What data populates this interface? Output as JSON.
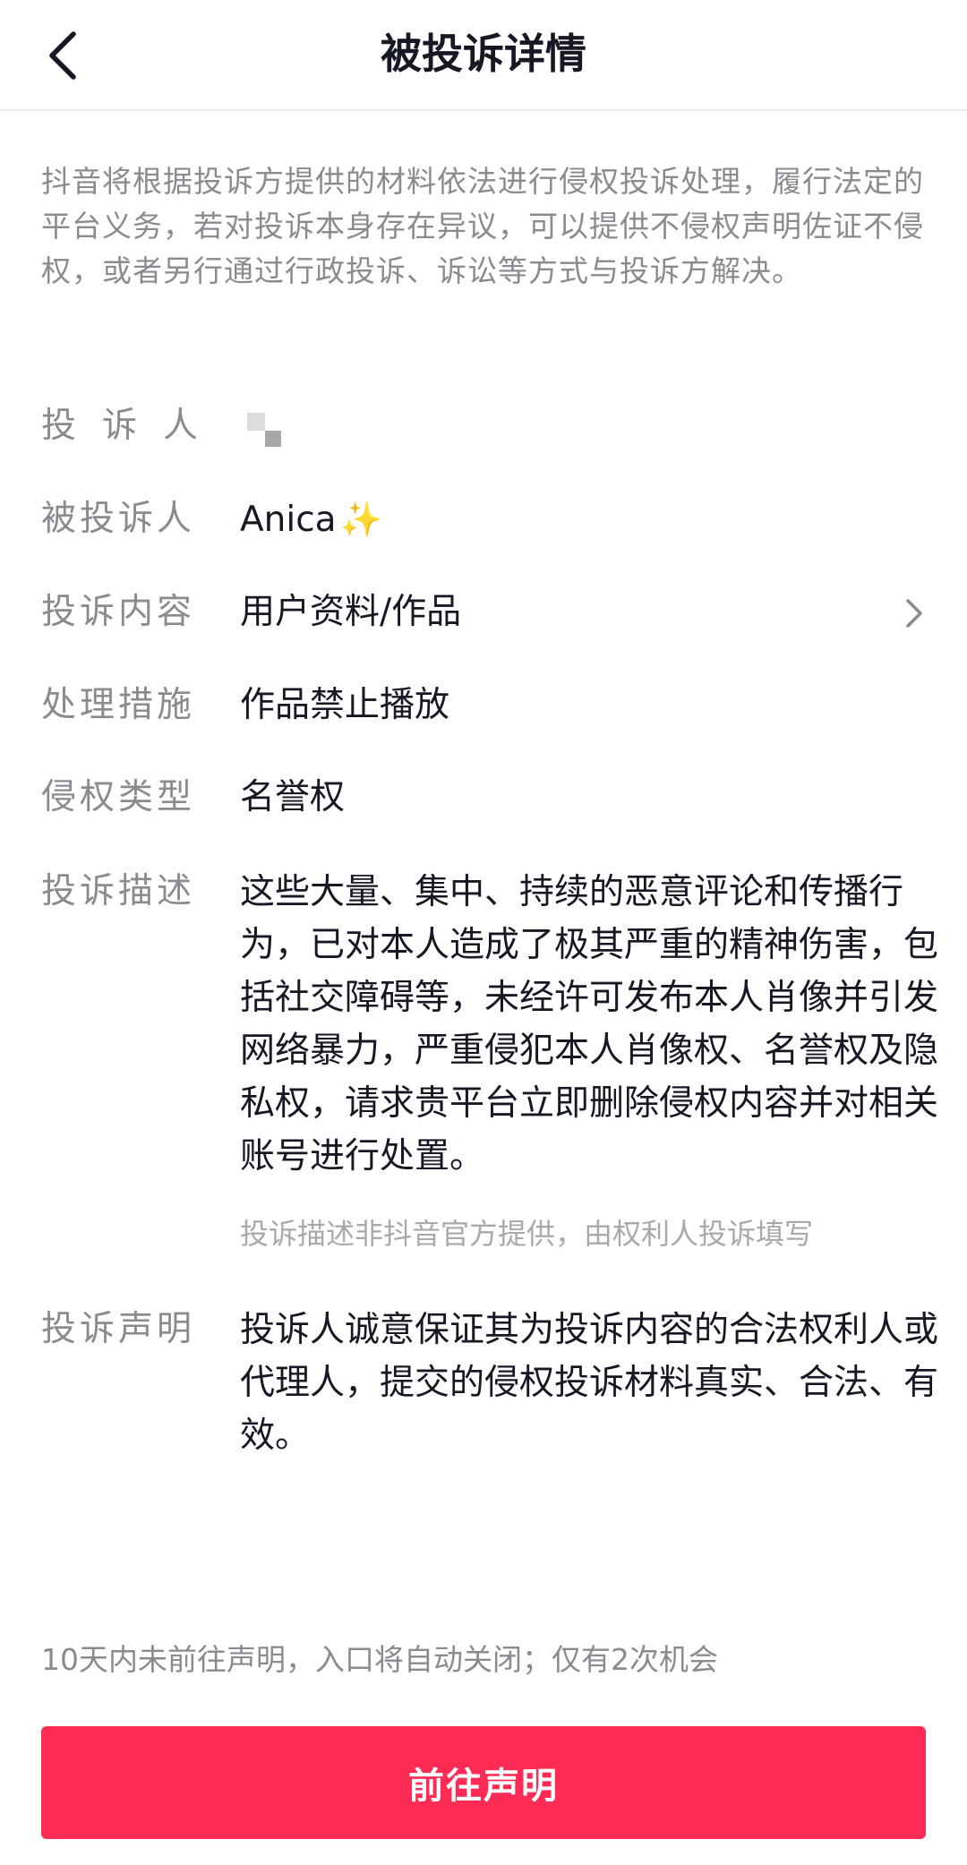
{
  "header": {
    "title": "被投诉详情",
    "back_icon": "chevron-left-icon"
  },
  "notice": "抖音将根据投诉方提供的材料依法进行侵权投诉处理，履行法定的平台义务，若对投诉本身存在异议，可以提供不侵权声明佐证不侵权，或者另行通过行政投诉、诉讼等方式与投诉方解决。",
  "details": {
    "complainant": {
      "label": "投诉人"
    },
    "respondent": {
      "label": "被投诉人",
      "value": "Anica",
      "emoji": "✨"
    },
    "content": {
      "label": "投诉内容",
      "value": "用户资料/作品"
    },
    "measure": {
      "label": "处理措施",
      "value": "作品禁止播放"
    },
    "type": {
      "label": "侵权类型",
      "value": "名誉权"
    },
    "description": {
      "label": "投诉描述",
      "value": "这些大量、集中、持续的恶意评论和传播行为，已对本人造成了极其严重的精神伤害，包括社交障碍等，未经许可发布本人肖像并引发网络暴力，严重侵犯本人肖像权、名誉权及隐私权，请求贵平台立即删除侵权内容并对相关账号进行处置。",
      "note": "投诉描述非抖音官方提供，由权利人投诉填写"
    },
    "statement": {
      "label": "投诉声明",
      "value": "投诉人诚意保证其为投诉内容的合法权利人或代理人，提交的侵权投诉材料真实、合法、有效。"
    }
  },
  "footer": {
    "deadline": "10天内未前往声明，入口将自动关闭；仅有2次机会",
    "button": "前往声明"
  },
  "colors": {
    "accent": "#fe2c55",
    "label": "#8a8b91",
    "text": "#161823"
  }
}
